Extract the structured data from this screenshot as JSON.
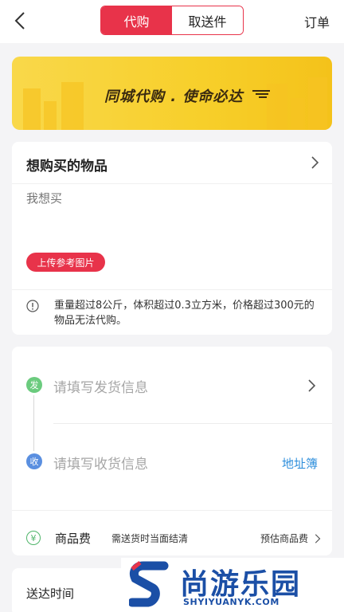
{
  "header": {
    "tabs": [
      {
        "label": "代购",
        "active": true
      },
      {
        "label": "取送件",
        "active": false
      }
    ],
    "orders_label": "订单",
    "icons": {
      "back": "chevron-left-icon"
    }
  },
  "banner": {
    "text": "同城代购 . 使命必达"
  },
  "purchase": {
    "title": "想购买的物品",
    "placeholder": "我想买",
    "upload_label": "上传参考图片",
    "notice": "重量超过8公斤，体积超过0.3立方米，价格超过300元的物品无法代购。"
  },
  "address": {
    "send_badge": "发",
    "send_placeholder": "请填写发货信息",
    "recv_badge": "收",
    "recv_placeholder": "请填写收货信息",
    "book_label": "地址簿"
  },
  "fee": {
    "icon_glyph": "¥",
    "label": "商品费",
    "desc": "需送货时当面结清",
    "estimate_label": "预估商品费"
  },
  "delivery": {
    "label": "送达时间"
  },
  "watermark": {
    "cn": "尚游乐园",
    "en": "SHYIYUANYK.COM"
  },
  "colors": {
    "accent": "#e8334a",
    "banner": "#f7cf2a",
    "send": "#6bcb7e",
    "recv": "#5a8fe0",
    "link": "#2f8fdc"
  }
}
